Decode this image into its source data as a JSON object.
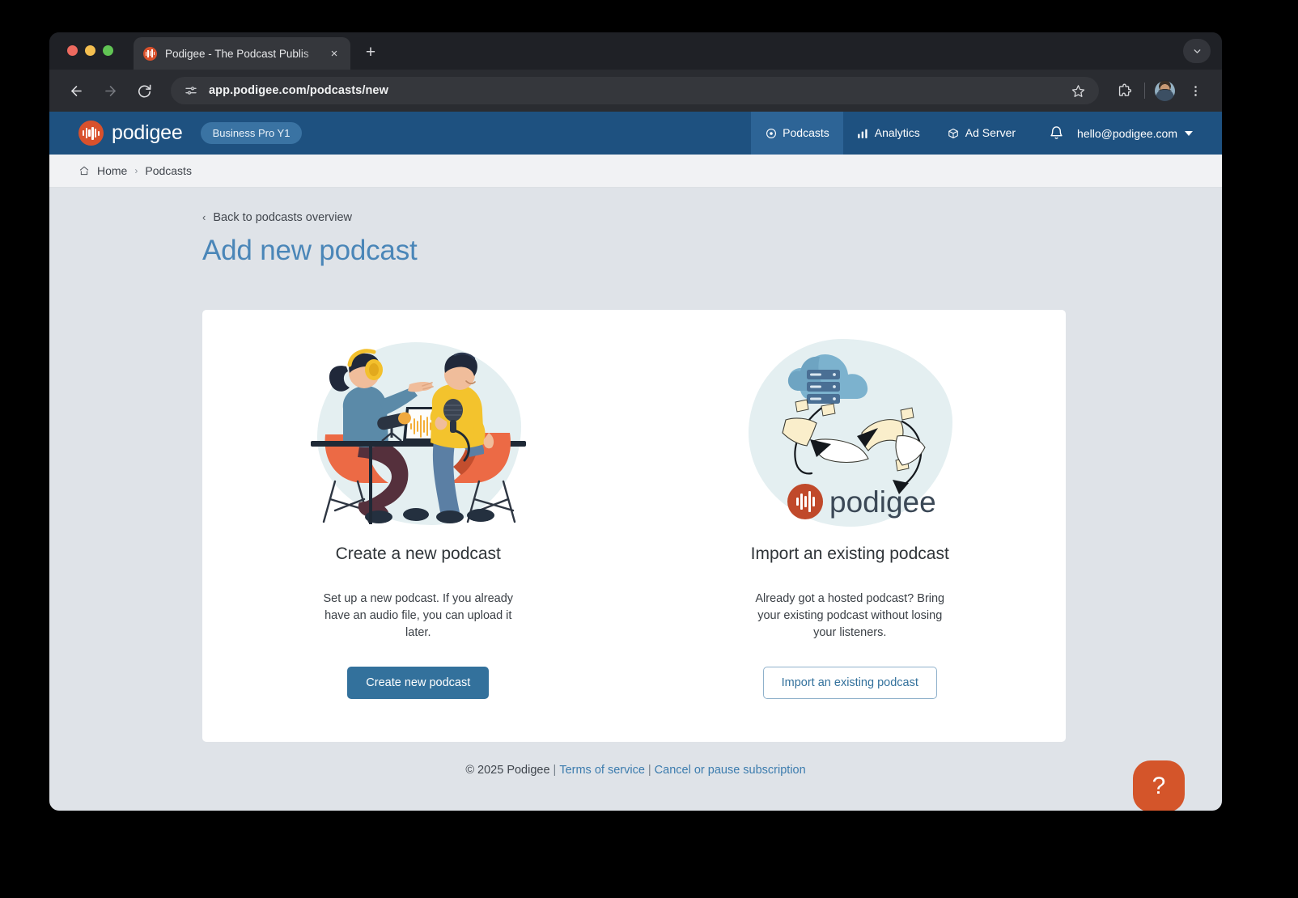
{
  "browser": {
    "tab": {
      "title": "Podigee - The Podcast Publis",
      "favicon_name": "podigee-favicon",
      "close_label": "×",
      "new_tab_label": "+"
    },
    "toolbar": {
      "back_label": "←",
      "forward_label": "→",
      "reload_label": "↻",
      "url": "app.podigee.com/podcasts/new",
      "site_info_name": "site-settings-icon",
      "bookmark_name": "bookmark-star-icon",
      "extensions_name": "extensions-puzzle-icon",
      "profile_name": "profile-avatar"
    },
    "window_chevron_name": "tab-search-chevron-icon"
  },
  "app_header": {
    "brand_name": "podigee",
    "plan_badge": "Business Pro Y1",
    "nav": [
      {
        "label": "Podcasts",
        "icon": "podcasts-circle-icon",
        "active": true
      },
      {
        "label": "Analytics",
        "icon": "analytics-bars-icon",
        "active": false
      },
      {
        "label": "Ad Server",
        "icon": "ad-server-cube-icon",
        "active": false
      }
    ],
    "notifications_icon": "bell-icon",
    "account_email": "hello@podigee.com",
    "account_caret": "chevron-down-icon"
  },
  "breadcrumb": {
    "home_icon": "home-icon",
    "items": [
      "Home",
      "Podcasts"
    ],
    "separator": "›"
  },
  "main": {
    "back_link": "Back to podcasts overview",
    "back_chevron": "‹",
    "page_title": "Add new podcast"
  },
  "cards": [
    {
      "illustration": "podcast-studio-illustration",
      "title": "Create a new podcast",
      "description": "Set up a new podcast. If you already have an audio file, you can upload it later.",
      "button_label": "Create new podcast",
      "button_style": "primary"
    },
    {
      "illustration": "podcast-migration-illustration",
      "title": "Import an existing podcast",
      "description": "Already got a hosted podcast? Bring your existing podcast without losing your listeners.",
      "button_label": "Import an existing podcast",
      "button_style": "outline"
    }
  ],
  "footer": {
    "copyright": "© 2025 Podigee",
    "pipe": "|",
    "terms_link": "Terms of service",
    "cancel_link": "Cancel or pause subscription"
  },
  "help_fab": {
    "label": "?"
  },
  "colors": {
    "header_blue": "#1e5180",
    "header_active_blue": "#2d6496",
    "plan_badge_blue": "#3a73a3",
    "title_blue": "#4a86b8",
    "primary_button": "#33719c",
    "link_blue": "#3c7cae",
    "brand_orange": "#d9512c",
    "help_orange": "#d4552a",
    "page_background": "#dfe3e8",
    "card_white": "#ffffff",
    "illustration_blob": "#e4eff1"
  }
}
